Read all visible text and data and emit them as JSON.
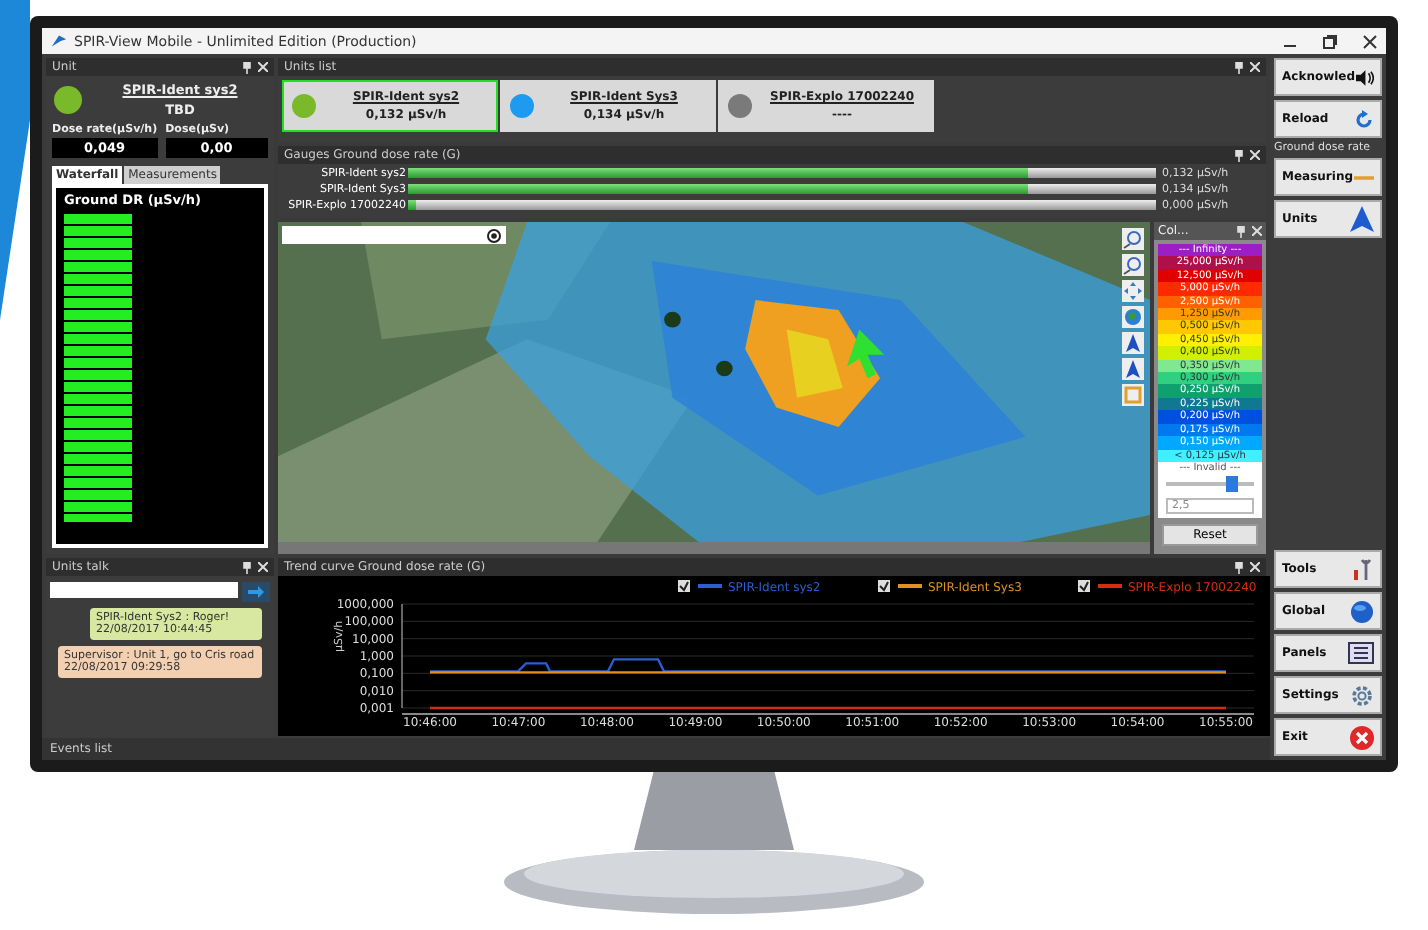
{
  "window": {
    "title": "SPIR-View Mobile - Unlimited Edition (Production)"
  },
  "unit_panel": {
    "title": "Unit",
    "name": "SPIR-Ident sys2",
    "status": "TBD",
    "color": "#7ab929",
    "fields": [
      {
        "label": "Dose rate(µSv/h)",
        "value": "0,049"
      },
      {
        "label": "Dose(µSv)",
        "value": "0,00"
      }
    ],
    "tabs": [
      {
        "label": "Waterfall",
        "selected": true
      },
      {
        "label": "Measurements",
        "selected": false
      }
    ],
    "waterfall_title": "Ground DR (µSv/h)"
  },
  "units_list": {
    "title": "Units list",
    "units": [
      {
        "name": "SPIR-Ident sys2",
        "reading": "0,132 µSv/h",
        "color": "#7ab929",
        "selected": true
      },
      {
        "name": "SPIR-Ident Sys3",
        "reading": "0,134 µSv/h",
        "color": "#1e9bf0",
        "selected": false
      },
      {
        "name": "SPIR-Explo 17002240",
        "reading": "----",
        "color": "#7a7a7a",
        "selected": false
      }
    ]
  },
  "gauges": {
    "title": "Gauges Ground dose rate (G)",
    "items": [
      {
        "name": "SPIR-Ident sys2",
        "level": 0.83,
        "reading": "0,132 µSv/h"
      },
      {
        "name": "SPIR-Ident Sys3",
        "level": 0.83,
        "reading": "0,134 µSv/h"
      },
      {
        "name": "SPIR-Explo 17002240",
        "level": 0.01,
        "reading": "0,000 µSv/h"
      }
    ]
  },
  "map": {
    "legend_title": "Col...",
    "legend": [
      {
        "label": "--- Infinity ---",
        "color": "#9b1fc4"
      },
      {
        "label": "25,000 µSv/h",
        "color": "#b0104a"
      },
      {
        "label": "12,500 µSv/h",
        "color": "#e00000"
      },
      {
        "label": "5,000 µSv/h",
        "color": "#ff2a00"
      },
      {
        "label": "2,500 µSv/h",
        "color": "#ff6000"
      },
      {
        "label": "1,250 µSv/h",
        "color": "#ff9a00"
      },
      {
        "label": "0,500 µSv/h",
        "color": "#ffc800"
      },
      {
        "label": "0,450 µSv/h",
        "color": "#fff000"
      },
      {
        "label": "0,400 µSv/h",
        "color": "#d0f000"
      },
      {
        "label": "0,350 µSv/h",
        "color": "#80e890"
      },
      {
        "label": "0,300 µSv/h",
        "color": "#30d080"
      },
      {
        "label": "0,250 µSv/h",
        "color": "#10a070"
      },
      {
        "label": "0,225 µSv/h",
        "color": "#107890"
      },
      {
        "label": "0,200 µSv/h",
        "color": "#0050e0"
      },
      {
        "label": "0,175 µSv/h",
        "color": "#0078f0"
      },
      {
        "label": "0,150 µSv/h",
        "color": "#00a8ff"
      },
      {
        "label": "< 0,125 µSv/h",
        "color": "#40f0ff"
      }
    ],
    "invalid_label": "--- Invalid ---",
    "threshold_slider": {
      "level": 0.75
    },
    "spin_value": "2,5",
    "reset": "Reset"
  },
  "units_talk": {
    "title": "Units talk",
    "messages": [
      {
        "text": "SPIR-Ident Sys2 : Roger!",
        "time": "22/08/2017 10:44:45",
        "kind": "incoming"
      },
      {
        "text": "Supervisor : Unit 1, go to Cris road",
        "time": "22/08/2017 09:29:58",
        "kind": "outgoing"
      }
    ]
  },
  "trend": {
    "title": "Trend curve Ground dose rate (G)",
    "ylabel": "µSv/h",
    "legend": [
      {
        "name": "SPIR-Ident sys2",
        "color": "#2a5fd0",
        "checked": true
      },
      {
        "name": "SPIR-Ident Sys3",
        "color": "#e09020",
        "checked": true
      },
      {
        "name": "SPIR-Explo 17002240",
        "color": "#d03010",
        "checked": true
      }
    ],
    "y_labels": [
      "1000,000",
      "100,000",
      "10,000",
      "1,000",
      "0,100",
      "0,010",
      "0,001"
    ],
    "x_labels": [
      "10:46:00",
      "10:47:00",
      "10:48:00",
      "10:49:00",
      "10:50:00",
      "10:51:00",
      "10:52:00",
      "10:53:00",
      "10:54:00",
      "10:55:00"
    ]
  },
  "events": {
    "title": "Events list"
  },
  "sidebar": {
    "top_buttons": [
      {
        "label": "Acknowled"
      },
      {
        "label": "Reload"
      }
    ],
    "section_label": "Ground dose rate",
    "mode_buttons": [
      {
        "label": "Measuring"
      },
      {
        "label": "Units"
      }
    ],
    "bottom_buttons": [
      {
        "label": "Tools"
      },
      {
        "label": "Global"
      },
      {
        "label": "Panels"
      },
      {
        "label": "Settings"
      },
      {
        "label": "Exit"
      }
    ]
  }
}
